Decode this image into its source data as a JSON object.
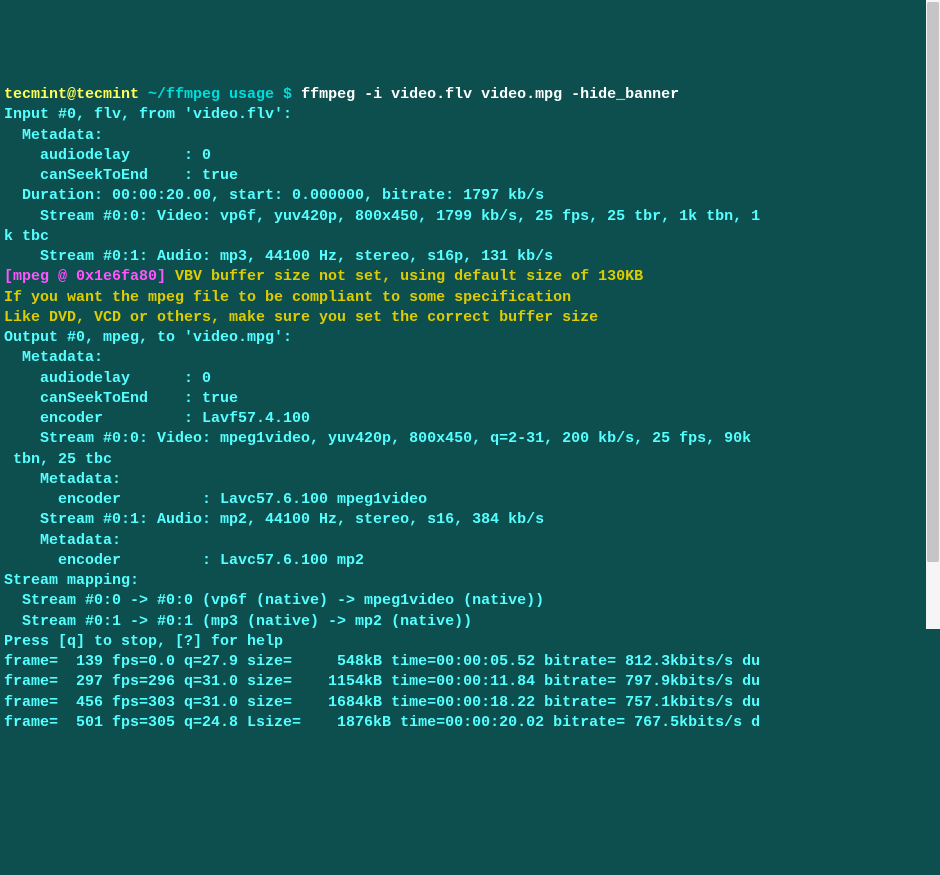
{
  "prompt": {
    "userhost": "tecmint@tecmint",
    "path": " ~/ffmpeg usage $ ",
    "command": "ffmpeg -i video.flv video.mpg -hide_banner"
  },
  "lines": {
    "l1": "Input #0, flv, from 'video.flv':",
    "l2": "  Metadata:",
    "l3": "    audiodelay      : 0",
    "l4": "    canSeekToEnd    : true",
    "l5": "  Duration: 00:00:20.00, start: 0.000000, bitrate: 1797 kb/s",
    "l6": "    Stream #0:0: Video: vp6f, yuv420p, 800x450, 1799 kb/s, 25 fps, 25 tbr, 1k tbn, 1",
    "l7": "k tbc",
    "l8": "    Stream #0:1: Audio: mp3, 44100 Hz, stereo, s16p, 131 kb/s",
    "warn_tag": "[mpeg @ 0x1e6fa80] ",
    "warn_msg": "VBV buffer size not set, using default size of 130KB",
    "l10": "If you want the mpeg file to be compliant to some specification",
    "l11": "Like DVD, VCD or others, make sure you set the correct buffer size",
    "l12": "Output #0, mpeg, to 'video.mpg':",
    "l13": "  Metadata:",
    "l14": "    audiodelay      : 0",
    "l15": "    canSeekToEnd    : true",
    "l16": "    encoder         : Lavf57.4.100",
    "l17": "    Stream #0:0: Video: mpeg1video, yuv420p, 800x450, q=2-31, 200 kb/s, 25 fps, 90k",
    "l18": " tbn, 25 tbc",
    "l19": "    Metadata:",
    "l20": "      encoder         : Lavc57.6.100 mpeg1video",
    "l21": "    Stream #0:1: Audio: mp2, 44100 Hz, stereo, s16, 384 kb/s",
    "l22": "    Metadata:",
    "l23": "      encoder         : Lavc57.6.100 mp2",
    "l24": "Stream mapping:",
    "l25": "  Stream #0:0 -> #0:0 (vp6f (native) -> mpeg1video (native))",
    "l26": "  Stream #0:1 -> #0:1 (mp3 (native) -> mp2 (native))",
    "l27": "Press [q] to stop, [?] for help",
    "f1": "frame=  139 fps=0.0 q=27.9 size=     548kB time=00:00:05.52 bitrate= 812.3kbits/s du",
    "f2": "frame=  297 fps=296 q=31.0 size=    1154kB time=00:00:11.84 bitrate= 797.9kbits/s du",
    "f3": "frame=  456 fps=303 q=31.0 size=    1684kB time=00:00:18.22 bitrate= 757.1kbits/s du",
    "f4": "frame=  501 fps=305 q=24.8 Lsize=    1876kB time=00:00:20.02 bitrate= 767.5kbits/s d"
  }
}
